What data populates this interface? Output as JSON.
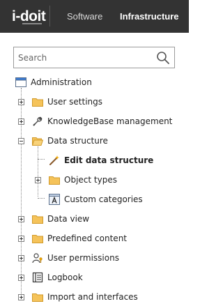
{
  "header": {
    "logo_text": "i-doit",
    "tabs": [
      {
        "label": "Software",
        "active": false
      },
      {
        "label": "Infrastructure",
        "active": true
      }
    ]
  },
  "search": {
    "placeholder": "Search",
    "value": "",
    "icon": "search-icon"
  },
  "tree": {
    "root": {
      "label": "Administration",
      "icon": "window-icon"
    },
    "items": [
      {
        "label": "User settings",
        "icon": "folder-icon",
        "expander": "plus",
        "level": 1
      },
      {
        "label": "KnowledgeBase management",
        "icon": "wrench-icon",
        "expander": "plus",
        "level": 1
      },
      {
        "label": "Data structure",
        "icon": "folder-open-icon",
        "expander": "minus",
        "level": 1
      },
      {
        "label": "Edit data structure",
        "icon": "magic-wand-icon",
        "expander": "none",
        "level": 2,
        "selected": true
      },
      {
        "label": "Object types",
        "icon": "folder-icon",
        "expander": "plus",
        "level": 2
      },
      {
        "label": "Custom categories",
        "icon": "text-box-icon",
        "expander": "none",
        "level": 2
      },
      {
        "label": "Data view",
        "icon": "folder-icon",
        "expander": "plus",
        "level": 1
      },
      {
        "label": "Predefined content",
        "icon": "folder-icon",
        "expander": "plus",
        "level": 1
      },
      {
        "label": "User permissions",
        "icon": "user-key-icon",
        "expander": "plus",
        "level": 1
      },
      {
        "label": "Logbook",
        "icon": "logbook-icon",
        "expander": "plus",
        "level": 1
      },
      {
        "label": "Import and interfaces",
        "icon": "folder-icon",
        "expander": "plus",
        "level": 1
      }
    ]
  },
  "colors": {
    "topbar": "#333333",
    "folder": "#f5c35a",
    "folder_border": "#d19a2a",
    "window_title": "#3a7bd5"
  }
}
